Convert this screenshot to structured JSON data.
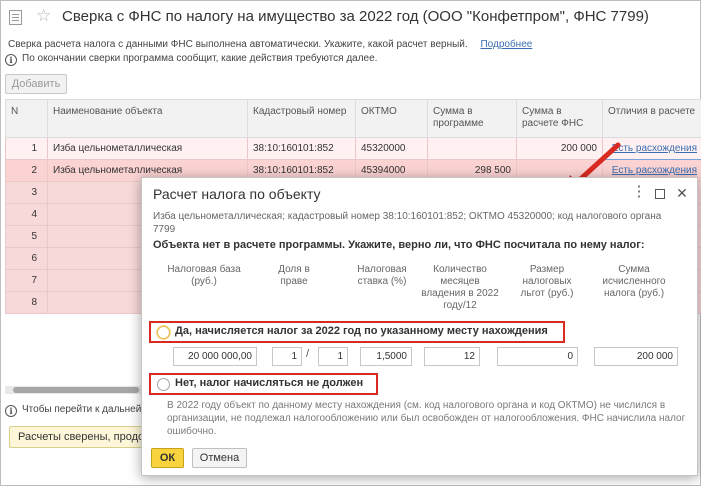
{
  "window": {
    "title": "Сверка с ФНС по налогу на имущество за 2022 год (ООО \"Конфетпром\", ФНС 7799)"
  },
  "info": {
    "line1": "Сверка расчета налога с данными ФНС выполнена автоматически. Укажите, какой расчет верный.",
    "details_link": "Подробнее",
    "line2": "По окончании сверки программа сообщит, какие действия требуются далее."
  },
  "toolbar": {
    "add_label": "Добавить"
  },
  "table": {
    "headers": [
      "N",
      "Наименование объекта",
      "Кадастровый номер",
      "ОКТМО",
      "Сумма в программе",
      "Сумма в расчете ФНС",
      "Отличия в расчете"
    ],
    "rows": [
      [
        "1",
        "Изба цельнометаллическая",
        "38:10:160101:852",
        "45320000",
        "",
        "200 000",
        "Есть расхождения"
      ],
      [
        "2",
        "Изба цельнометаллическая",
        "38:10:160101:852",
        "45394000",
        "298 500",
        "",
        "Есть расхождения"
      ],
      [
        "3",
        "",
        "",
        "",
        "",
        "",
        ""
      ],
      [
        "4",
        "",
        "",
        "",
        "",
        "",
        ""
      ],
      [
        "5",
        "",
        "",
        "",
        "",
        "",
        ""
      ],
      [
        "6",
        "",
        "",
        "",
        "",
        "",
        ""
      ],
      [
        "7",
        "",
        "",
        "",
        "",
        "",
        ""
      ],
      [
        "8",
        "",
        "",
        "",
        "",
        "",
        ""
      ]
    ]
  },
  "footer": {
    "hint": "Чтобы перейти к дальней",
    "done_label": "Расчеты сверены, продолж"
  },
  "dialog": {
    "title": "Расчет налога по объекту",
    "description": "Изба цельнометаллическая; кадастровый номер 38:10:160101:852; ОКТМО 45320000; код налогового органа 7799",
    "question": "Объекта нет в расчете программы. Укажите, верно ли, что ФНС посчитала по нему налог:",
    "columns": {
      "base": "Налоговая база (руб.)",
      "share": "Доля в праве",
      "rate": "Налоговая ставка (%)",
      "months": "Количество месяцев владения в 2022 году/12",
      "benefit": "Размер налоговых льгот (руб.)",
      "tax": "Сумма исчисленного налога (руб.)"
    },
    "option_yes": "Да, начисляется налог за 2022 год по указанному месту нахождения",
    "option_no": "Нет, налог начисляться не должен",
    "values": {
      "base": "20 000 000,00",
      "share_num": "1",
      "share_sep": "/",
      "share_den": "1",
      "rate": "1,5000",
      "months": "12",
      "benefit": "0",
      "tax": "200 000"
    },
    "note": "В 2022 году объект по данному месту нахождения (см. код налогового органа и код ОКТМО) не числился в организации, не подлежал налогообложению или был освобожден от налогообложения. ФНС начислила налог ошибочно.",
    "ok_label": "ОК",
    "cancel_label": "Отмена",
    "more_icon": "⋮",
    "close_icon": "✕"
  },
  "colors": {
    "row_highlight": "#fbd3d3",
    "annotation_red": "#d92a22",
    "ok_button": "#f8d33d",
    "link": "#3b6fb3"
  }
}
